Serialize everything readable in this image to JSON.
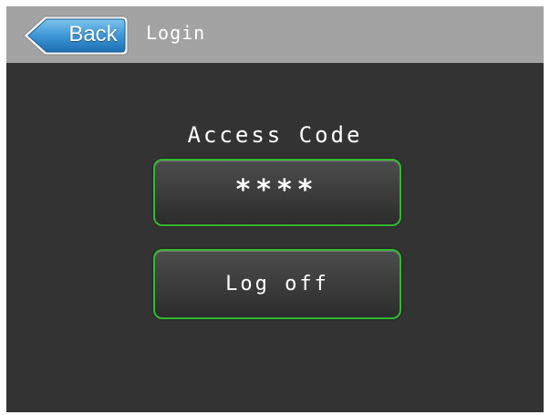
{
  "colors": {
    "header_bg": "#a3a3a3",
    "screen_bg": "#333333",
    "back_button": "#2e8bd0",
    "button_border": "#31b931"
  },
  "header": {
    "back_label": "Back",
    "back_icon": "arrow-left-icon",
    "title": "Login"
  },
  "access": {
    "label": "Access Code",
    "masked_value": "****"
  },
  "actions": {
    "log_off_label": "Log off"
  }
}
